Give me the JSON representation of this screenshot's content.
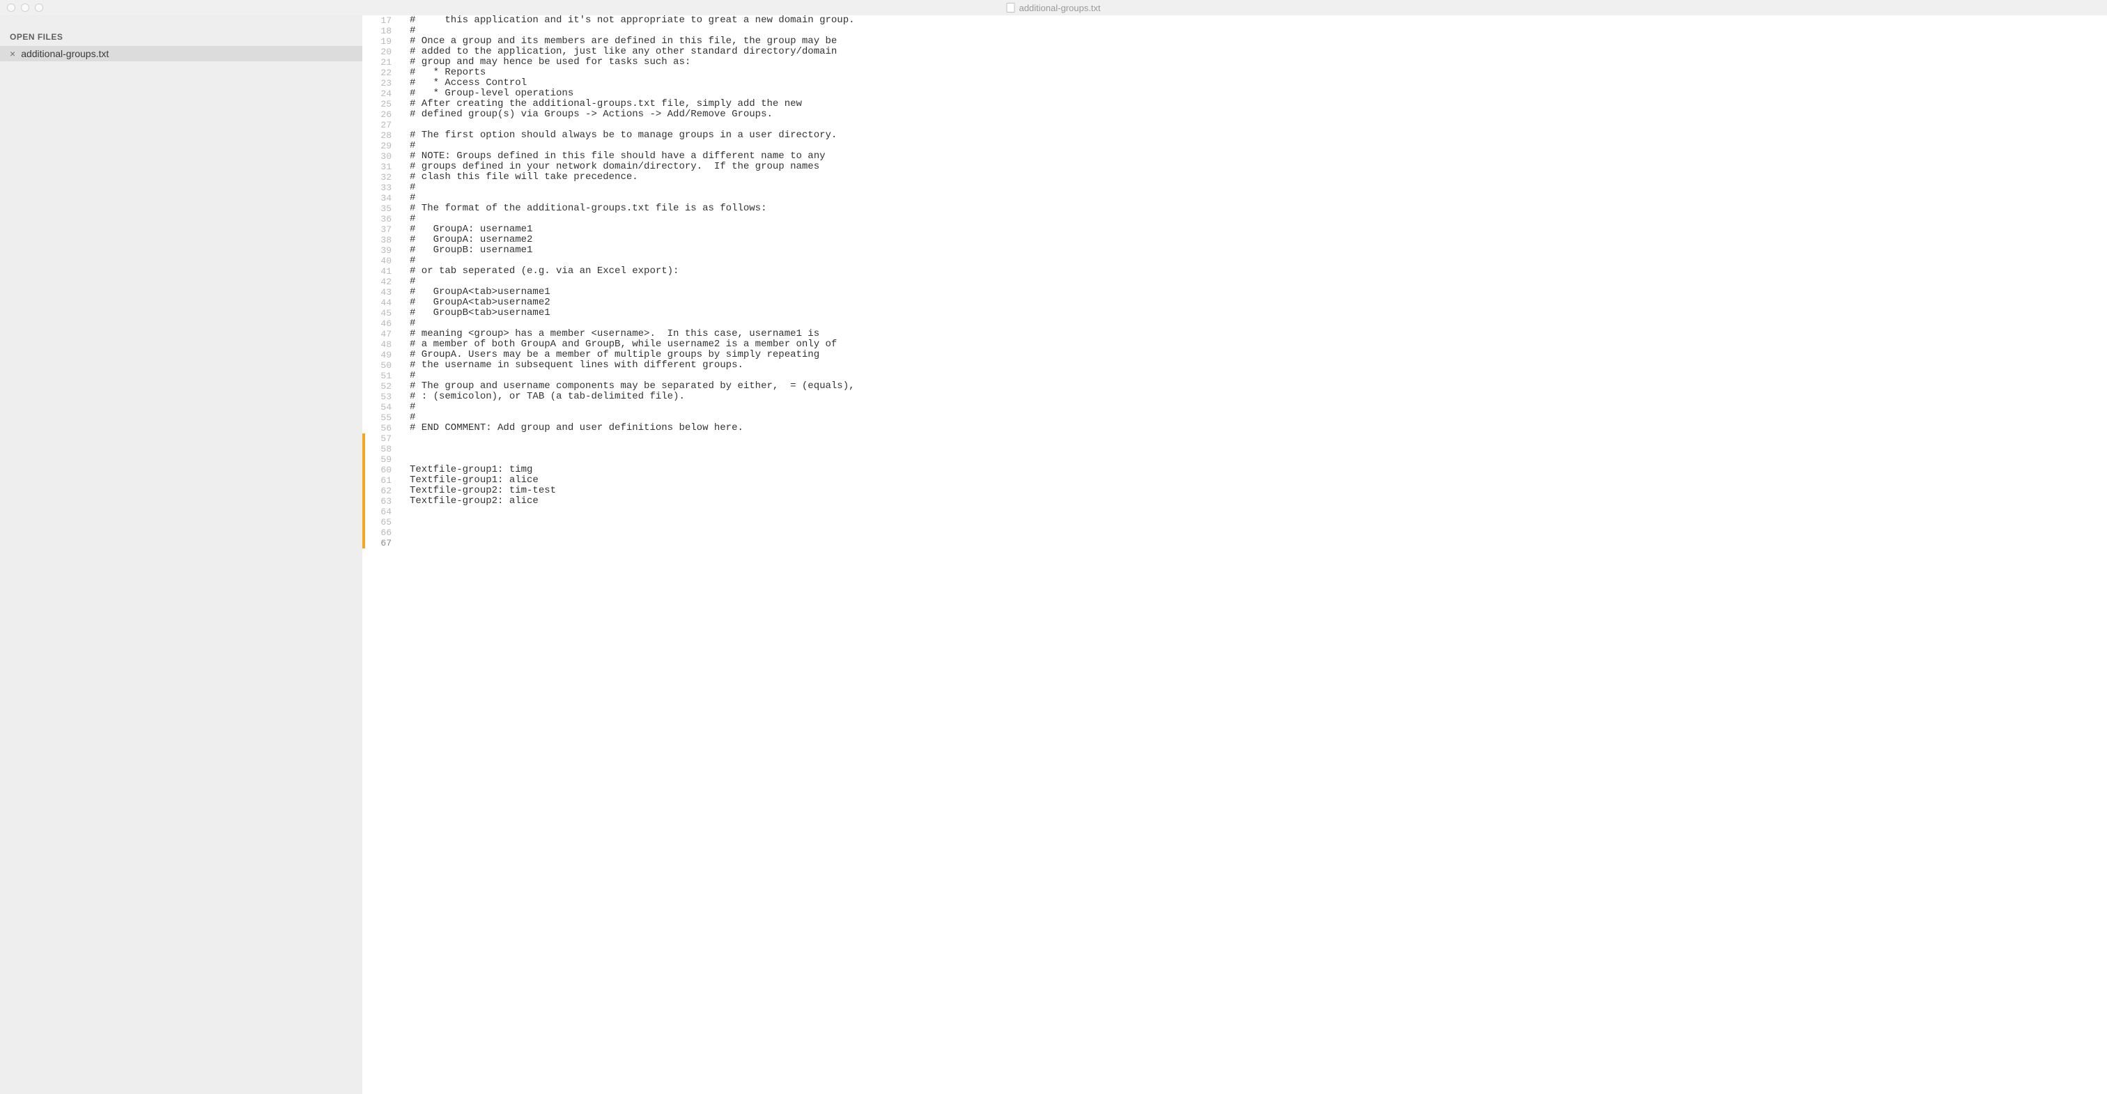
{
  "window": {
    "title": "additional-groups.txt"
  },
  "sidebar": {
    "open_files_label": "OPEN FILES",
    "files": [
      {
        "name": "additional-groups.txt",
        "close_glyph": "×"
      }
    ]
  },
  "editor": {
    "first_line_number": 17,
    "modified_from": 57,
    "current_line": 67,
    "lines": [
      "#     this application and it's not appropriate to great a new domain group.",
      "#",
      "# Once a group and its members are defined in this file, the group may be",
      "# added to the application, just like any other standard directory/domain",
      "# group and may hence be used for tasks such as:",
      "#   * Reports",
      "#   * Access Control",
      "#   * Group-level operations",
      "# After creating the additional-groups.txt file, simply add the new",
      "# defined group(s) via Groups -> Actions -> Add/Remove Groups.",
      "",
      "# The first option should always be to manage groups in a user directory.",
      "#",
      "# NOTE: Groups defined in this file should have a different name to any",
      "# groups defined in your network domain/directory.  If the group names",
      "# clash this file will take precedence.",
      "#",
      "#",
      "# The format of the additional-groups.txt file is as follows:",
      "#",
      "#   GroupA: username1",
      "#   GroupA: username2",
      "#   GroupB: username1",
      "#",
      "# or tab seperated (e.g. via an Excel export):",
      "#",
      "#   GroupA<tab>username1",
      "#   GroupA<tab>username2",
      "#   GroupB<tab>username1",
      "#",
      "# meaning <group> has a member <username>.  In this case, username1 is",
      "# a member of both GroupA and GroupB, while username2 is a member only of",
      "# GroupA. Users may be a member of multiple groups by simply repeating",
      "# the username in subsequent lines with different groups.",
      "#",
      "# The group and username components may be separated by either,  = (equals),",
      "# : (semicolon), or TAB (a tab-delimited file).",
      "#",
      "#",
      "# END COMMENT: Add group and user definitions below here.",
      "",
      "",
      "",
      "Textfile-group1: timg",
      "Textfile-group1: alice",
      "Textfile-group2: tim-test",
      "Textfile-group2: alice",
      "",
      "",
      "",
      ""
    ]
  }
}
